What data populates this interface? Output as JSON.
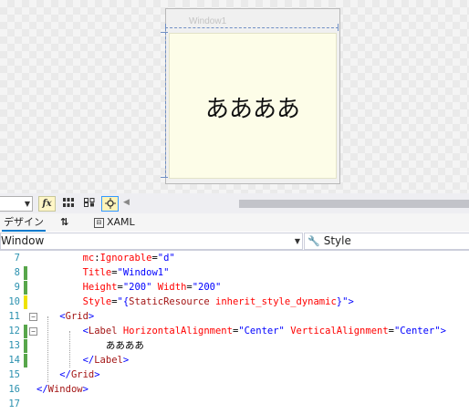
{
  "designer": {
    "window_title": "Window1",
    "label_content": "ああああ"
  },
  "toolbar": {
    "zoom_value": "",
    "fx_label": "fx"
  },
  "tabs": {
    "design": "デザイン",
    "swap": "⇅",
    "xaml": "XAML"
  },
  "selectors": {
    "element": "Window",
    "property": "Style"
  },
  "editor": {
    "line_numbers": [
      "7",
      "8",
      "9",
      "10",
      "11",
      "12",
      "13",
      "14",
      "15",
      "16",
      "17"
    ],
    "lines": [
      [
        {
          "t": "        "
        },
        {
          "t": "mc",
          "c": "t-a"
        },
        {
          "t": ":",
          "c": "t-x"
        },
        {
          "t": "Ignorable",
          "c": "t-a"
        },
        {
          "t": "=",
          "c": "t-x"
        },
        {
          "t": "\"d\"",
          "c": "t-v"
        }
      ],
      [
        {
          "t": "        "
        },
        {
          "t": "Title",
          "c": "t-a"
        },
        {
          "t": "=",
          "c": "t-x"
        },
        {
          "t": "\"Window1\"",
          "c": "t-v"
        }
      ],
      [
        {
          "t": "        "
        },
        {
          "t": "Height",
          "c": "t-a"
        },
        {
          "t": "=",
          "c": "t-x"
        },
        {
          "t": "\"200\"",
          "c": "t-v"
        },
        {
          "t": " "
        },
        {
          "t": "Width",
          "c": "t-a"
        },
        {
          "t": "=",
          "c": "t-x"
        },
        {
          "t": "\"200\"",
          "c": "t-v"
        }
      ],
      [
        {
          "t": "        "
        },
        {
          "t": "Style",
          "c": "t-a"
        },
        {
          "t": "=",
          "c": "t-x"
        },
        {
          "t": "\"{",
          "c": "t-v"
        },
        {
          "t": "StaticResource",
          "c": "t-m"
        },
        {
          "t": " "
        },
        {
          "t": "inherit_style_dynamic",
          "c": "t-a"
        },
        {
          "t": "}\"",
          "c": "t-v"
        },
        {
          "t": ">",
          "c": "t-b"
        }
      ],
      [
        {
          "t": "    "
        },
        {
          "t": "<",
          "c": "t-b"
        },
        {
          "t": "Grid",
          "c": "t-m"
        },
        {
          "t": ">",
          "c": "t-b"
        }
      ],
      [
        {
          "t": "        "
        },
        {
          "t": "<",
          "c": "t-b"
        },
        {
          "t": "Label",
          "c": "t-m"
        },
        {
          "t": " "
        },
        {
          "t": "HorizontalAlignment",
          "c": "t-a"
        },
        {
          "t": "=",
          "c": "t-x"
        },
        {
          "t": "\"Center\"",
          "c": "t-v"
        },
        {
          "t": " "
        },
        {
          "t": "VerticalAlignment",
          "c": "t-a"
        },
        {
          "t": "=",
          "c": "t-x"
        },
        {
          "t": "\"Center\"",
          "c": "t-v"
        },
        {
          "t": ">",
          "c": "t-b"
        }
      ],
      [
        {
          "t": "            ああああ",
          "c": "t-x"
        }
      ],
      [
        {
          "t": "        "
        },
        {
          "t": "</",
          "c": "t-b"
        },
        {
          "t": "Label",
          "c": "t-m"
        },
        {
          "t": ">",
          "c": "t-b"
        }
      ],
      [
        {
          "t": "    "
        },
        {
          "t": "</",
          "c": "t-b"
        },
        {
          "t": "Grid",
          "c": "t-m"
        },
        {
          "t": ">",
          "c": "t-b"
        }
      ],
      [
        {
          "t": "</",
          "c": "t-b"
        },
        {
          "t": "Window",
          "c": "t-m"
        },
        {
          "t": ">",
          "c": "t-b"
        }
      ],
      []
    ],
    "change_markers": [
      "",
      "green",
      "green",
      "yellow",
      "",
      "green",
      "green",
      "green",
      "",
      "",
      ""
    ],
    "fold_rows": [
      4,
      5
    ]
  },
  "colors": {
    "accent": "#007acc",
    "change_saved": "#57a64a",
    "change_unsaved": "#efe200",
    "line_number": "#2b91af"
  }
}
